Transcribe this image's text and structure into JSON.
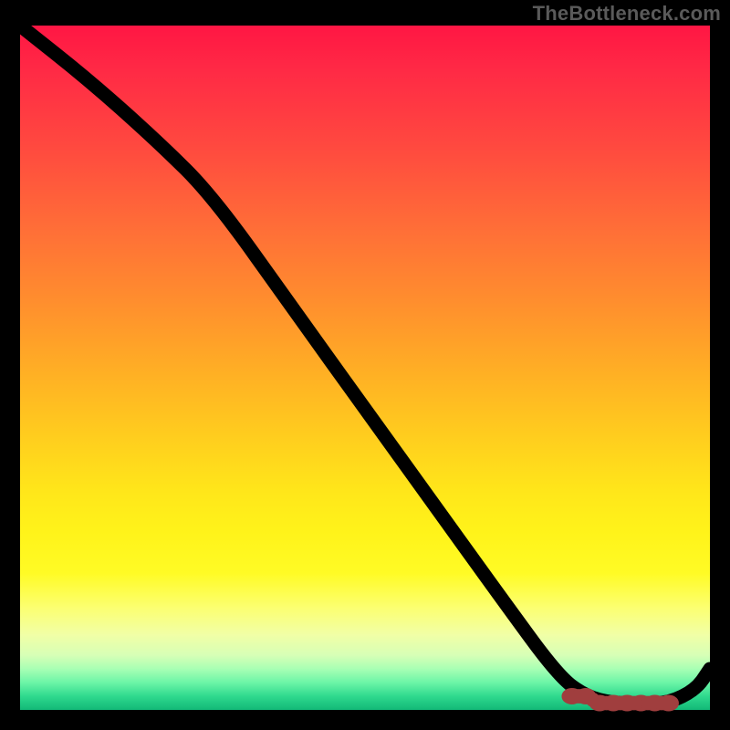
{
  "watermark": "TheBottleneck.com",
  "colors": {
    "background": "#000000",
    "curve": "#000000",
    "marker_fill": "#cf5b5b",
    "marker_stroke": "#a03e3e",
    "watermark": "#5a5a5a"
  },
  "chart_data": {
    "type": "line",
    "title": "",
    "xlabel": "",
    "ylabel": "",
    "xlim": [
      0,
      100
    ],
    "ylim": [
      0,
      100
    ],
    "grid": false,
    "legend": false,
    "series": [
      {
        "name": "bottleneck-curve",
        "x": [
          0,
          10,
          20,
          28,
          40,
          50,
          60,
          70,
          78,
          82,
          86,
          90,
          94,
          98,
          100
        ],
        "values": [
          100,
          92,
          83,
          75,
          58,
          44,
          30,
          16,
          5,
          2,
          1,
          1,
          1,
          3,
          6
        ]
      }
    ],
    "markers": {
      "name": "optimal-range",
      "style": "dashed-segment",
      "x": [
        80,
        82,
        84,
        86,
        88,
        90,
        92,
        94
      ],
      "values": [
        2,
        2,
        1,
        1,
        1,
        1,
        1,
        1
      ]
    },
    "gradient_stops": [
      {
        "pos": 0.0,
        "color": "#ff1644"
      },
      {
        "pos": 0.18,
        "color": "#ff4a3f"
      },
      {
        "pos": 0.4,
        "color": "#ff8d2e"
      },
      {
        "pos": 0.6,
        "color": "#ffcd1e"
      },
      {
        "pos": 0.8,
        "color": "#fffb25"
      },
      {
        "pos": 0.92,
        "color": "#d7ffb6"
      },
      {
        "pos": 1.0,
        "color": "#12b877"
      }
    ]
  }
}
